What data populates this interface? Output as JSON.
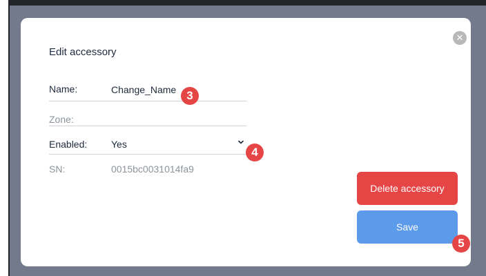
{
  "dialog": {
    "title": "Edit accessory",
    "close_icon": "close-icon",
    "fields": {
      "name_label": "Name:",
      "name_value": "Change_Name",
      "zone_label": "Zone:",
      "zone_value": "",
      "enabled_label": "Enabled:",
      "enabled_value": "Yes",
      "sn_label": "SN:",
      "sn_value": "0015bc0031014fa9"
    },
    "delete_label": "Delete accessory",
    "save_label": "Save"
  },
  "annotations": {
    "badge_name": "3",
    "badge_enabled": "4",
    "badge_save": "5"
  },
  "colors": {
    "backdrop": "#727a8b",
    "delete_button": "#e64545",
    "save_button": "#5c9bea",
    "badge": "#e64545"
  }
}
